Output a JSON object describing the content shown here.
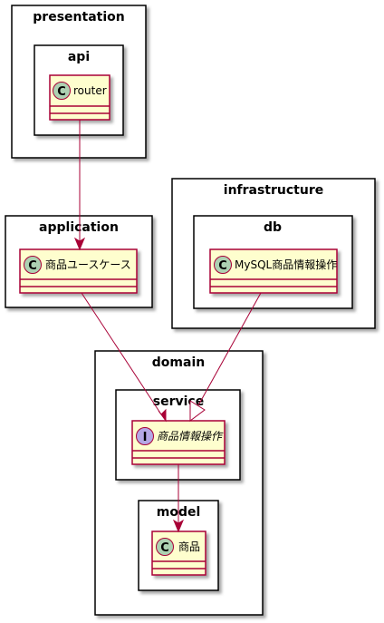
{
  "colors": {
    "class_fill": "#FEFECE",
    "class_border": "#A80036",
    "class_circle": "#ADD1B2",
    "interface_circle": "#B4A7E5",
    "arrow": "#A80036",
    "package_border": "#000000"
  },
  "packages": {
    "presentation": "presentation",
    "api": "api",
    "application": "application",
    "infrastructure": "infrastructure",
    "db": "db",
    "domain": "domain",
    "service": "service",
    "model": "model"
  },
  "classes": {
    "router": {
      "name": "router",
      "stereotype": "C"
    },
    "usecase": {
      "name": "商品ユースケース",
      "stereotype": "C"
    },
    "mysql": {
      "name": "MySQL商品情報操作",
      "stereotype": "C"
    },
    "service_interface": {
      "name": "商品情報操作",
      "stereotype": "I"
    },
    "product": {
      "name": "商品",
      "stereotype": "C"
    }
  },
  "relations": [
    {
      "from": "router",
      "to": "商品ユースケース",
      "kind": "dependency"
    },
    {
      "from": "商品ユースケース",
      "to": "商品情報操作",
      "kind": "dependency"
    },
    {
      "from": "MySQL商品情報操作",
      "to": "商品情報操作",
      "kind": "realization"
    },
    {
      "from": "商品情報操作",
      "to": "商品",
      "kind": "dependency"
    }
  ]
}
